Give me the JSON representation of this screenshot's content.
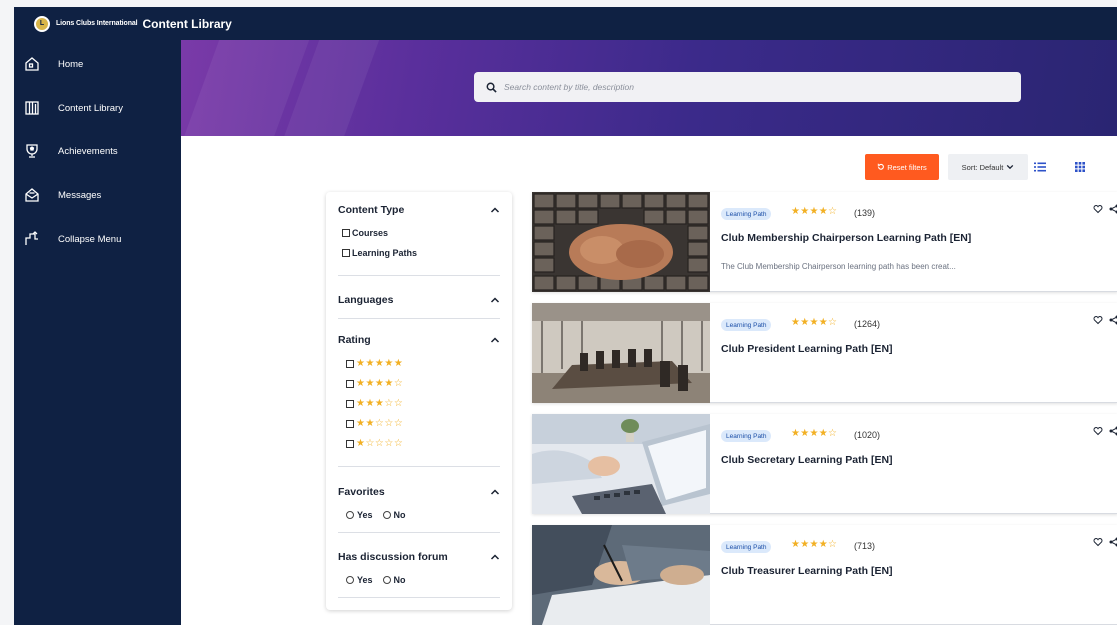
{
  "header": {
    "brand": "Lions Clubs International",
    "app_title": "Content Library",
    "logo_icon": "lions-seal-logo"
  },
  "sidebar": {
    "items": [
      {
        "label": "Home",
        "icon": "home-icon"
      },
      {
        "label": "Content Library",
        "icon": "library-icon"
      },
      {
        "label": "Achievements",
        "icon": "trophy-icon"
      },
      {
        "label": "Messages",
        "icon": "messages-icon"
      },
      {
        "label": "Collapse Menu",
        "icon": "collapse-icon"
      }
    ]
  },
  "search": {
    "placeholder": "Search content by title, description"
  },
  "toolbar": {
    "reset_label": "Reset filters",
    "sort_label": "Sort: Default"
  },
  "filters": {
    "content_type": {
      "title": "Content Type",
      "options": [
        "Courses",
        "Learning Paths"
      ]
    },
    "languages": {
      "title": "Languages"
    },
    "rating": {
      "title": "Rating",
      "options": [
        "★★★★★",
        "★★★★☆",
        "★★★☆☆",
        "★★☆☆☆",
        "★☆☆☆☆"
      ]
    },
    "favorites": {
      "title": "Favorites",
      "options": [
        "Yes",
        "No"
      ]
    },
    "discussion": {
      "title": "Has discussion forum",
      "options": [
        "Yes",
        "No"
      ]
    }
  },
  "cards": [
    {
      "badge": "Learning Path",
      "stars": "★★★★☆",
      "count": "(139)",
      "title": "Club Membership Chairperson Learning Path [EN]",
      "description": "The Club Membership Chairperson learning path has been creat..."
    },
    {
      "badge": "Learning Path",
      "stars": "★★★★☆",
      "count": "(1264)",
      "title": "Club President Learning Path [EN]",
      "description": ""
    },
    {
      "badge": "Learning Path",
      "stars": "★★★★☆",
      "count": "(1020)",
      "title": "Club Secretary Learning Path [EN]",
      "description": ""
    },
    {
      "badge": "Learning Path",
      "stars": "★★★★☆",
      "count": "(713)",
      "title": "Club Treasurer Learning Path [EN]",
      "description": ""
    }
  ],
  "colors": {
    "nav_bg": "#0f2143",
    "accent_orange": "#ff5a1f",
    "star": "#f2b024",
    "badge_bg": "#dbe9fb"
  }
}
